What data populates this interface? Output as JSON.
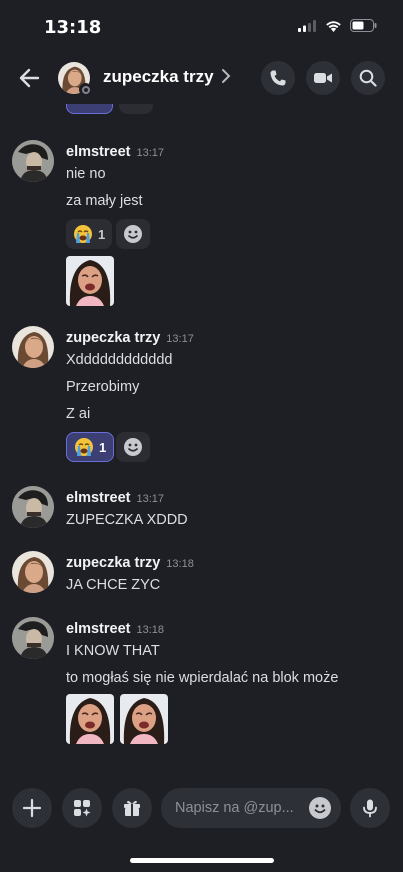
{
  "status_bar": {
    "time": "13:18"
  },
  "header": {
    "title": "zupeczka trzy"
  },
  "messages": [
    {
      "author": "elmstreet",
      "time": "13:17",
      "lines": [
        "nie no",
        "za mały jest"
      ],
      "reaction_count": "1"
    },
    {
      "author": "zupeczka trzy",
      "time": "13:17",
      "lines": [
        "Xdddddddddddd",
        "Przerobimy",
        "Z ai"
      ],
      "reaction_count": "1"
    },
    {
      "author": "elmstreet",
      "time": "13:17",
      "lines": [
        "ZUPECZKA XDDD"
      ]
    },
    {
      "author": "zupeczka trzy",
      "time": "13:18",
      "lines": [
        "JA CHCE ZYC"
      ]
    },
    {
      "author": "elmstreet",
      "time": "13:18",
      "lines": [
        "I KNOW THAT",
        "to mogłaś się nie wpierdalać na blok może"
      ]
    }
  ],
  "composer": {
    "placeholder": "Napisz na @zup..."
  },
  "icons": {
    "back": "arrow-left-icon",
    "call": "phone-icon",
    "video": "video-camera-icon",
    "search": "search-icon",
    "add": "plus-icon",
    "apps": "apps-icon",
    "gift": "gift-icon",
    "emoji": "emoji-icon",
    "mic": "microphone-icon",
    "reaction": "crying-emoji-icon",
    "add_reaction": "add-reaction-icon"
  },
  "colors": {
    "background": "#1e1f24",
    "reaction_active": "#3b3f73",
    "reaction_border": "#6a6fd8"
  }
}
